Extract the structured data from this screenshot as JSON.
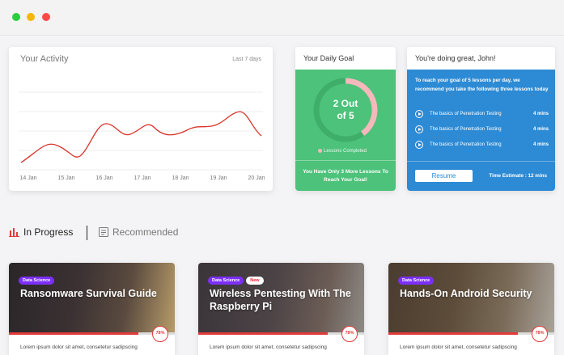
{
  "window": {
    "controls": [
      "close",
      "minimize",
      "maximize"
    ]
  },
  "activity": {
    "title": "Your Activity",
    "range": "Last 7 days",
    "x_labels": [
      "14 Jan",
      "15 Jan",
      "16 Jan",
      "17 Jan",
      "18 Jan",
      "19 Jan",
      "20 Jan"
    ],
    "line_color": "#d9342b"
  },
  "goal": {
    "title": "Your Daily Goal",
    "progress_line1": "2 Out",
    "progress_line2": "of 5",
    "completed": 2,
    "total": 5,
    "legend": "Lessons Completed",
    "note_line1": "You Have Only 3 More Lessons To",
    "note_line2": "Reach Your Goal!",
    "colors": {
      "bg": "#4cc27a",
      "ring": "#f5b8bb"
    }
  },
  "suggest": {
    "title": "You're doing great, John!",
    "intro": "To reach your goal of 5 lessons per day, we recommend you take the following three lessons today",
    "lessons": [
      {
        "name": "The basics of Penetration Testing",
        "duration": "4 mins"
      },
      {
        "name": "The basics of Penetration Testing",
        "duration": "4 mins"
      },
      {
        "name": "The basics of Penetration Testing",
        "duration": "4 mins"
      }
    ],
    "resume_label": "Resume",
    "estimate": "Time Estimate : 12 mins",
    "color": "#2d8ad4"
  },
  "tabs": {
    "in_progress": "In Progress",
    "recommended": "Recommended"
  },
  "courses": [
    {
      "category": "Data Science",
      "badge_new": "",
      "title": "Ransomware Survival Guide",
      "progress": 78,
      "progress_label": "78%",
      "desc": "Lorem ipsum dolor sit amet, consetetur sadipscing"
    },
    {
      "category": "Data Science",
      "badge_new": "New",
      "title": "Wireless Pentesting With The Raspberry Pi",
      "progress": 78,
      "progress_label": "78%",
      "desc": "Lorem ipsum dolor sit amet, consetetur sadipscing"
    },
    {
      "category": "Data Science",
      "badge_new": "",
      "title": "Hands-On Android Security",
      "progress": 78,
      "progress_label": "78%",
      "desc": "Lorem ipsum dolor sit amet, consetetur sadipscing"
    }
  ]
}
